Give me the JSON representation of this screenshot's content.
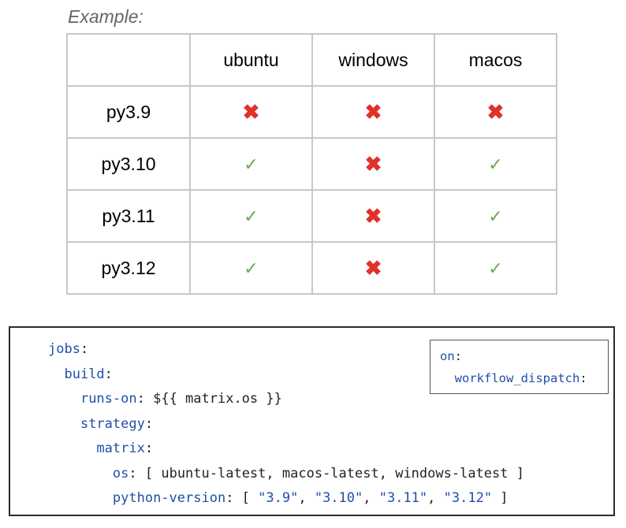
{
  "caption": "Example:",
  "table": {
    "columns": [
      "",
      "ubuntu",
      "windows",
      "macos"
    ],
    "rows": [
      {
        "label": "py3.9",
        "cells": [
          "✖",
          "✖",
          "✖"
        ]
      },
      {
        "label": "py3.10",
        "cells": [
          "✓",
          "✖",
          "✓"
        ]
      },
      {
        "label": "py3.11",
        "cells": [
          "✓",
          "✖",
          "✓"
        ]
      },
      {
        "label": "py3.12",
        "cells": [
          "✓",
          "✖",
          "✓"
        ]
      }
    ],
    "colors": {
      "cross": "#e0312a",
      "check": "#6aa84f",
      "border": "#c8c8c8"
    }
  },
  "code": {
    "jobs": "jobs",
    "build": "build",
    "runs_on_key": "runs-on",
    "runs_on_value": "${{ matrix.os }}",
    "strategy": "strategy",
    "matrix": "matrix",
    "os_key": "os",
    "os_open": "[ ",
    "os_values": [
      "ubuntu-latest",
      "macos-latest",
      "windows-latest"
    ],
    "os_close": " ]",
    "python_key": "python-version",
    "python_open": "[ ",
    "python_values": [
      "\"3.9\"",
      "\"3.10\"",
      "\"3.11\"",
      "\"3.12\""
    ],
    "python_close": " ]",
    "key_color": "#1f4fa8"
  },
  "trigger": {
    "on": "on",
    "event": "workflow_dispatch"
  }
}
